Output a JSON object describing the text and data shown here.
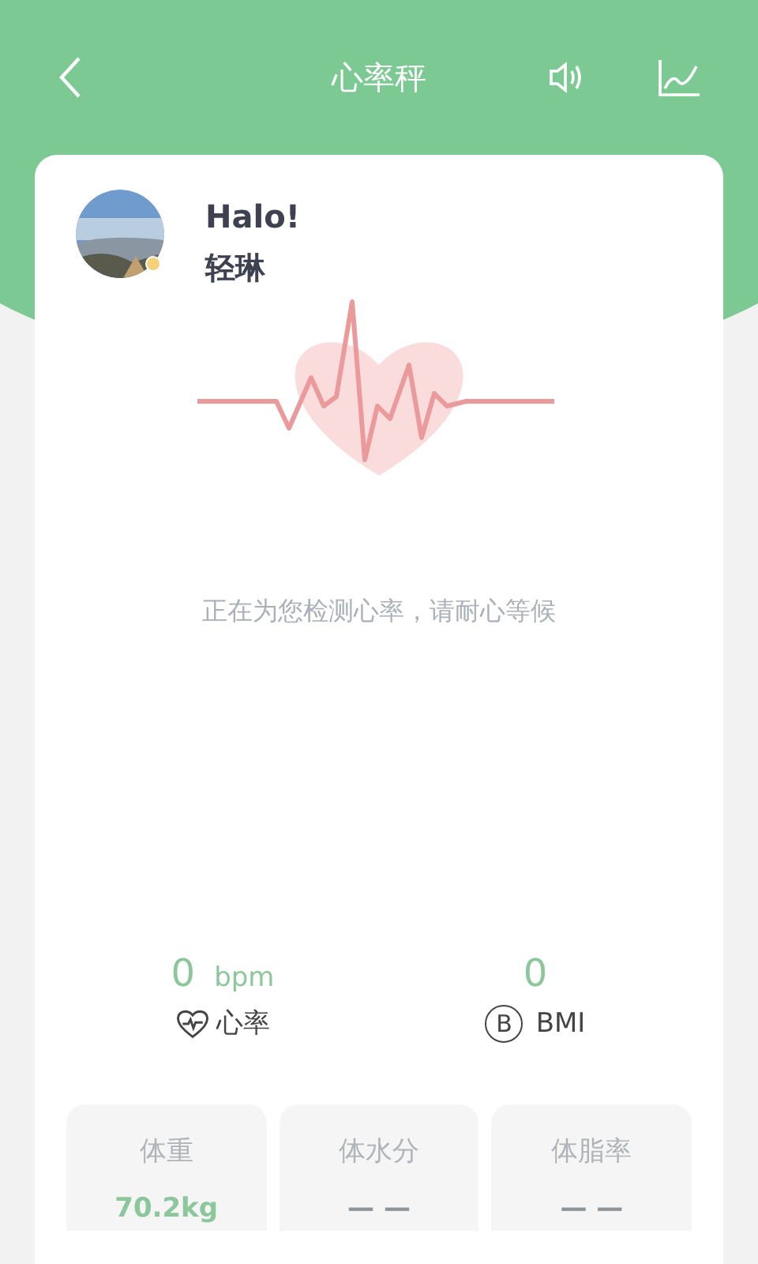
{
  "header": {
    "title": "心率秤"
  },
  "user": {
    "greeting": "Halo!",
    "name": "轻琳"
  },
  "status": "正在为您检测心率，请耐心等候",
  "stats": [
    {
      "kind": "heart",
      "value": "0",
      "unit": "bpm",
      "label": "心率"
    },
    {
      "kind": "bmi",
      "value": "0",
      "badge": "B",
      "label": "BMI"
    }
  ],
  "tiles": [
    {
      "label": "体重",
      "value": "70.2kg",
      "highlight": true
    },
    {
      "label": "体水分",
      "value": "— —",
      "highlight": false
    },
    {
      "label": "体脂率",
      "value": "— —",
      "highlight": false
    }
  ]
}
